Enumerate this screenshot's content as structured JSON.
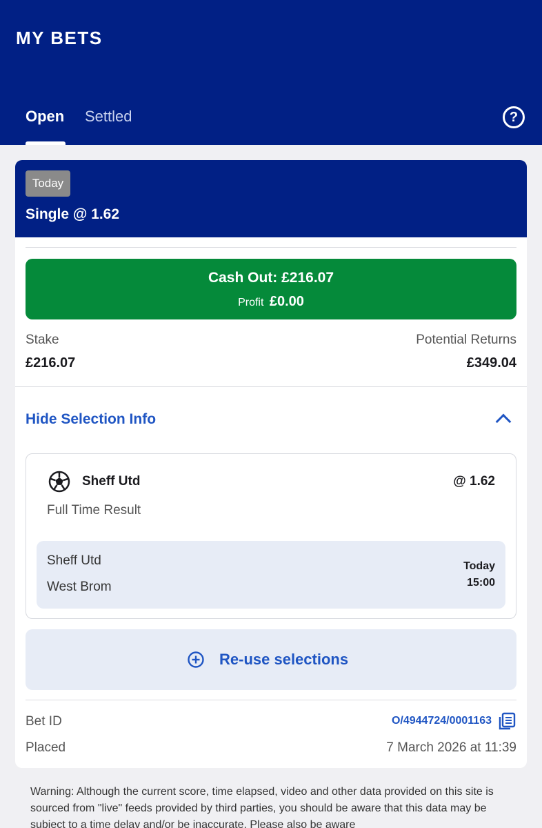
{
  "header": {
    "title": "MY BETS",
    "tabs": [
      {
        "label": "Open",
        "active": true
      },
      {
        "label": "Settled",
        "active": false
      }
    ],
    "help_icon": "?"
  },
  "bet": {
    "badge": "Today",
    "type_label": "Single @ 1.62",
    "cash_out": {
      "label": "Cash Out: £216.07",
      "profit_label": "Profit",
      "profit_value": "£0.00"
    },
    "stake_label": "Stake",
    "stake_value": "£216.07",
    "returns_label": "Potential Returns",
    "returns_value": "£349.04",
    "toggle_label": "Hide Selection Info",
    "selection": {
      "name": "Sheff Utd",
      "odds": "@ 1.62",
      "market": "Full Time Result",
      "event": {
        "home": "Sheff Utd",
        "away": "West Brom",
        "day": "Today",
        "time": "15:00"
      }
    },
    "reuse_label": "Re-use selections",
    "bet_id_label": "Bet ID",
    "bet_id_value": "O/4944724/0001163",
    "placed_label": "Placed",
    "placed_value": "7 March 2026 at 11:39"
  },
  "warning": "Warning: Although the current score, time elapsed, video and other data provided on this site is sourced from \"live\" feeds provided by third parties, you should be aware that this data may be subject to a time delay and/or be inaccurate. Please also be aware",
  "colors": {
    "brand_blue": "#012085",
    "cash_out_green": "#058a3a",
    "link_blue": "#1f55c3",
    "badge_grey": "#8a8a8a"
  }
}
